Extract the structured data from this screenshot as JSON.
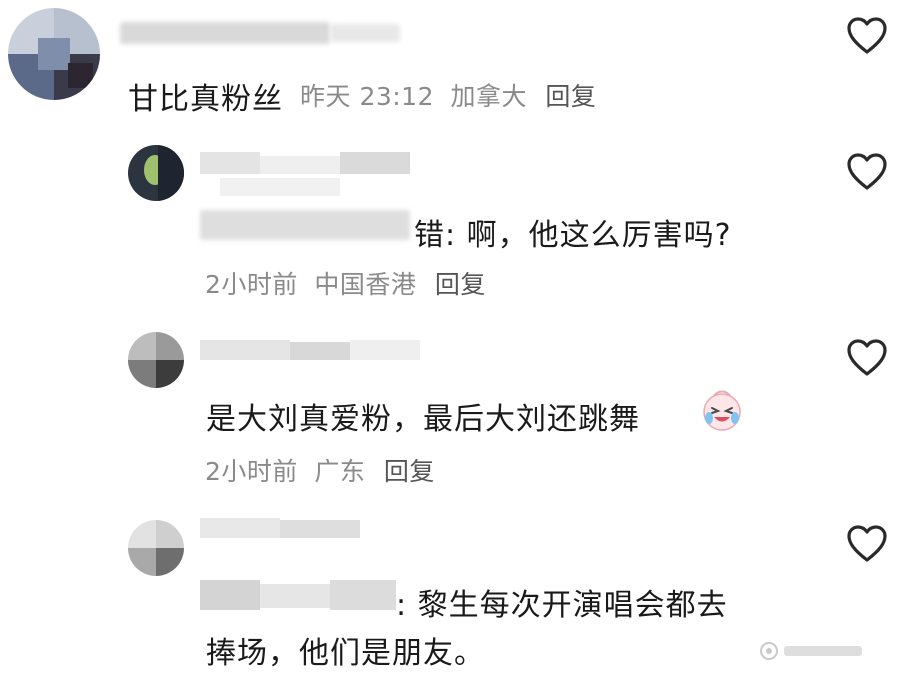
{
  "comments": [
    {
      "text": "甘比真粉丝",
      "time": "昨天 23:12",
      "location": "加拿大",
      "reply": "回复"
    },
    {
      "text_suffix": "错: 啊，他这么厉害吗?",
      "time": "2小时前",
      "location": "中国香港",
      "reply": "回复"
    },
    {
      "text": "是大刘真爱粉，最后大刘还跳舞",
      "emoji": "crying-laughing-emoji",
      "time": "2小时前",
      "location": "广东",
      "reply": "回复"
    },
    {
      "text_line1": ": 黎生每次开演唱会都去",
      "text_line2": "捧场，他们是朋友。"
    }
  ],
  "icons": {
    "like": "heart-outline-icon"
  },
  "colors": {
    "meta": "#8a8a8a",
    "text": "#1a1a1a",
    "heart": "#2a2a2a"
  }
}
